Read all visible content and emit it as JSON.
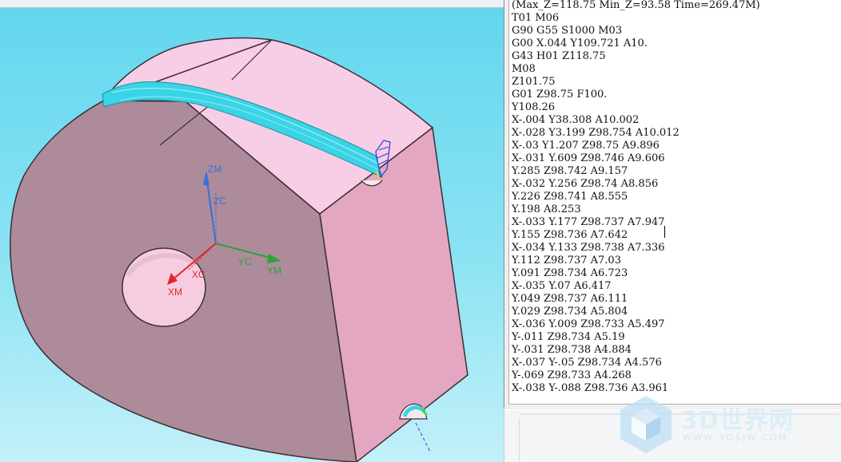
{
  "viewport": {
    "axis_labels": {
      "zm": "ZM",
      "zc": "ZC",
      "yc": "YC",
      "ym": "YM",
      "xc": "XC",
      "xm": "XM"
    },
    "colors": {
      "part_face": "#f8cde6",
      "part_side": "#ad8b9a",
      "toolpath": "#39d4e6",
      "axis_z": "#3a6fd8",
      "axis_y": "#2fa23a",
      "axis_x": "#e0262a"
    }
  },
  "code_window": {
    "lines": [
      "(Max_Z=118.75 Min_Z=93.58 Time=269.47M)",
      "T01 M06",
      "G90 G55 S1000 M03",
      "G00 X.044 Y109.721 A10.",
      "G43 H01 Z118.75",
      "M08",
      "Z101.75",
      "G01 Z98.75 F100.",
      "Y108.26",
      "X-.004 Y38.308 A10.002",
      "X-.028 Y3.199 Z98.754 A10.012",
      "X-.03 Y1.207 Z98.75 A9.896",
      "X-.031 Y.609 Z98.746 A9.606",
      "Y.285 Z98.742 A9.157",
      "X-.032 Y.256 Z98.74 A8.856",
      "Y.226 Z98.741 A8.555",
      "Y.198 A8.253",
      "X-.033 Y.177 Z98.737 A7.947",
      "Y.155 Z98.736 A7.642",
      "X-.034 Y.133 Z98.738 A7.336",
      "Y.112 Z98.737 A7.03",
      "Y.091 Z98.734 A6.723",
      "X-.035 Y.07 A6.417",
      "Y.049 Z98.737 A6.111",
      "Y.029 Z98.734 A5.804",
      "X-.036 Y.009 Z98.733 A5.497",
      "Y-.011 Z98.734 A5.19",
      "Y-.031 Z98.738 A4.884",
      "X-.037 Y-.05 Z98.734 A4.576",
      "Y-.069 Z98.733 A4.268",
      "X-.038 Y-.088 Z98.736 A3.961"
    ]
  },
  "watermark": {
    "text": "3D世界网",
    "url": "WWW.3DSJW.COM"
  }
}
